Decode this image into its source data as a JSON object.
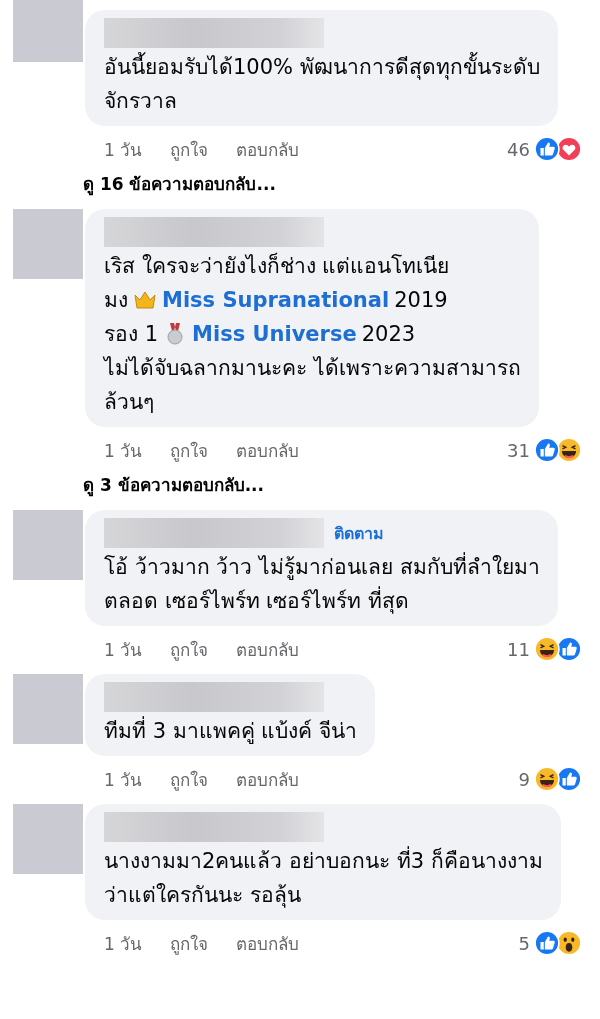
{
  "comments": [
    {
      "lines": [
        [
          {
            "kind": "text",
            "text": "อันนี้ยอมรับได้100% พัฒนาการดีสุดทุกขั้นระดับ"
          }
        ],
        [
          {
            "kind": "text",
            "text": "จักรวาล"
          }
        ]
      ],
      "time": "1 วัน",
      "like": "ถูกใจ",
      "reply": "ตอบกลับ",
      "count": "46",
      "reactions": [
        {
          "kind": "like"
        },
        {
          "kind": "love"
        }
      ],
      "view_replies": "ดู 16 ข้อความตอบกลับ..."
    },
    {
      "lines": [
        [
          {
            "kind": "text",
            "text": "เริส ใครจะว่ายังไงก็ช่าง แต่แอนโทเนีย"
          }
        ],
        [
          {
            "kind": "text",
            "text": "มง"
          },
          {
            "kind": "crown"
          },
          {
            "kind": "link",
            "text": "Miss Supranational"
          },
          {
            "kind": "text",
            "text": "2019"
          }
        ],
        [
          {
            "kind": "text",
            "text": "รอง 1"
          },
          {
            "kind": "medal"
          },
          {
            "kind": "link",
            "text": "Miss Universe"
          },
          {
            "kind": "text",
            "text": "2023"
          }
        ],
        [
          {
            "kind": "text",
            "text": "ไม่ได้จับฉลากมานะคะ ได้เพราะความสามารถ"
          }
        ],
        [
          {
            "kind": "text",
            "text": "ล้วนๆ"
          }
        ]
      ],
      "time": "1 วัน",
      "like": "ถูกใจ",
      "reply": "ตอบกลับ",
      "count": "31",
      "reactions": [
        {
          "kind": "like"
        },
        {
          "kind": "haha"
        }
      ],
      "view_replies": "ดู 3 ข้อความตอบกลับ..."
    },
    {
      "follow": "ติดตาม",
      "lines": [
        [
          {
            "kind": "text",
            "text": "โอ้ ว้าวมาก ว้าว ไม่รู้มาก่อนเลย สมกับที่ลำใยมา"
          }
        ],
        [
          {
            "kind": "text",
            "text": "ตลอด เซอร์ไพร์ท เซอร์ไพร์ท ที่สุด"
          }
        ]
      ],
      "time": "1 วัน",
      "like": "ถูกใจ",
      "reply": "ตอบกลับ",
      "count": "11",
      "reactions": [
        {
          "kind": "haha"
        },
        {
          "kind": "like"
        }
      ]
    },
    {
      "lines": [
        [
          {
            "kind": "text",
            "text": "ทีมที่ 3 มาแพคคู่ แบ้งค์ จีน่า"
          }
        ]
      ],
      "time": "1 วัน",
      "like": "ถูกใจ",
      "reply": "ตอบกลับ",
      "count": "9",
      "reactions": [
        {
          "kind": "haha"
        },
        {
          "kind": "like"
        }
      ]
    },
    {
      "lines": [
        [
          {
            "kind": "text",
            "text": "นางงามมา2คนแล้ว อย่าบอกนะ ที่3 ก็คือนางงาม"
          }
        ],
        [
          {
            "kind": "text",
            "text": "ว่าแต่ใครกันนะ รอลุ้น"
          }
        ]
      ],
      "time": "1 วัน",
      "like": "ถูกใจ",
      "reply": "ตอบกลับ",
      "count": "5",
      "reactions": [
        {
          "kind": "like"
        },
        {
          "kind": "wow"
        }
      ]
    }
  ]
}
